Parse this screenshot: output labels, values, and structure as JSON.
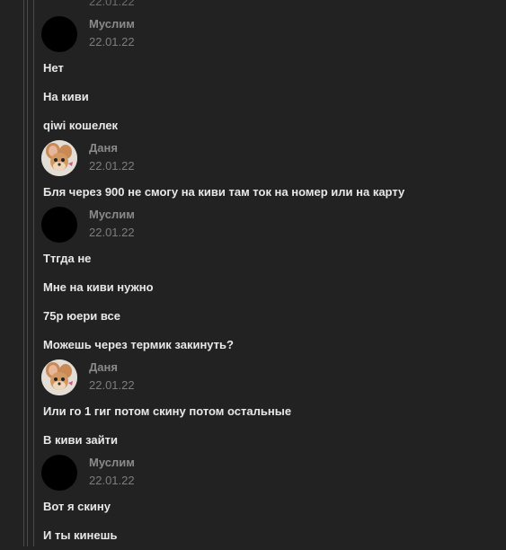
{
  "top_partial": {
    "date": "22.01.22"
  },
  "groups": [
    {
      "author": "Муслим",
      "date": "22.01.22",
      "avatar": "black-avatar",
      "lines": [
        "Нет",
        "На киви",
        "qiwi кошелек"
      ]
    },
    {
      "author": "Даня",
      "date": "22.01.22",
      "avatar": "jerry-mouse-avatar",
      "lines": [
        "Бля через 900 не смогу на киви там ток на номер или на карту"
      ]
    },
    {
      "author": "Муслим",
      "date": "22.01.22",
      "avatar": "black-avatar",
      "lines": [
        "Ттгда не",
        "Мне на киви нужно",
        "75р юери все",
        "Можешь через термик закинуть?"
      ]
    },
    {
      "author": "Даня",
      "date": "22.01.22",
      "avatar": "jerry-mouse-avatar",
      "lines": [
        "Или го 1 гиг потом скину потом остальные",
        "В киви зайти"
      ]
    },
    {
      "author": "Муслим",
      "date": "22.01.22",
      "avatar": "black-avatar",
      "lines": [
        "Вот я скину",
        "И ты кинешь"
      ]
    }
  ],
  "colors": {
    "background": "#222222",
    "text": "#e8e8e8",
    "author": "#8a8a8a",
    "date": "#7d7d7d",
    "rail": "#4a4a4a"
  }
}
